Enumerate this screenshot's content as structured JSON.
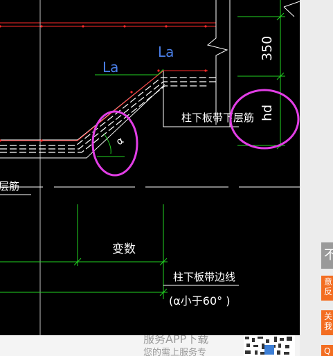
{
  "drawing": {
    "label_la_upper": "La",
    "label_la_lower": "La",
    "dim_350": "350",
    "dim_hd": "hd",
    "label_column_lower_bar": "柱下板带下层筋",
    "label_layer_bar": "层筋",
    "angle_symbol": "α",
    "label_variable": "变数",
    "label_column_edge": "柱下板带边线",
    "label_angle_condition": "(α小于60° )"
  },
  "page_behind": {
    "text_line1": "服务APP下载",
    "text_line2": "您的需上服务专"
  },
  "side_tabs": {
    "tab_grey": "不",
    "tab_feedback": "意反",
    "tab_about": "关我",
    "tab_q": "Q"
  },
  "colors": {
    "background": "#000000",
    "red_line": "#ff2a2a",
    "white_line": "#ffffff",
    "green_line": "#22d422",
    "blue_text": "#4a7fe8",
    "magenta_highlight": "#e23ee6",
    "accent_orange": "#f36d21"
  }
}
